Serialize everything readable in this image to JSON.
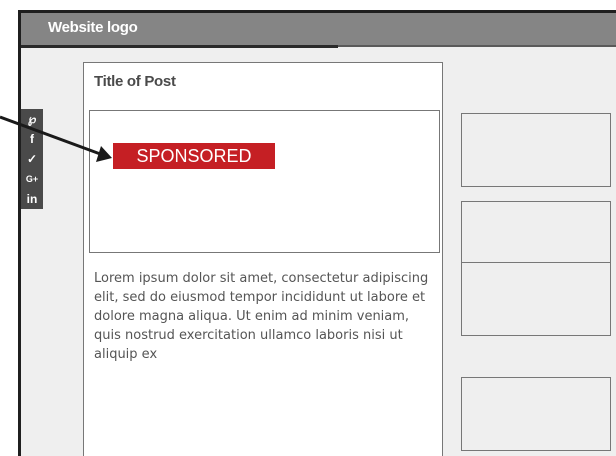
{
  "header": {
    "logo_text": "Website logo"
  },
  "post": {
    "title": "Title of Post",
    "badge": "SPONSORED",
    "excerpt": "Lorem ipsum dolor sit amet, consectetur adipiscing elit, sed do eiusmod tempor incididunt ut labore et dolore magna aliqua. Ut enim ad minim veniam, quis nostrud exercitation ullamco laboris nisi ut aliquip ex"
  },
  "social": {
    "items": [
      {
        "icon": "pinterest-icon",
        "glyph": "℘"
      },
      {
        "icon": "facebook-icon",
        "glyph": "f"
      },
      {
        "icon": "twitter-icon",
        "glyph": "✓"
      },
      {
        "icon": "google-plus-icon",
        "glyph": "G+"
      },
      {
        "icon": "linkedin-icon",
        "glyph": "in"
      }
    ]
  },
  "sidebar": {
    "ad_boxes": [
      {
        "name": "ad-box-1"
      },
      {
        "name": "ad-box-2"
      },
      {
        "name": "ad-box-3"
      },
      {
        "name": "ad-box-4"
      }
    ]
  },
  "colors": {
    "header_bg": "#858585",
    "page_bg": "#efefef",
    "badge_bg": "#c51f24",
    "social_bg": "#4a4a4a"
  }
}
